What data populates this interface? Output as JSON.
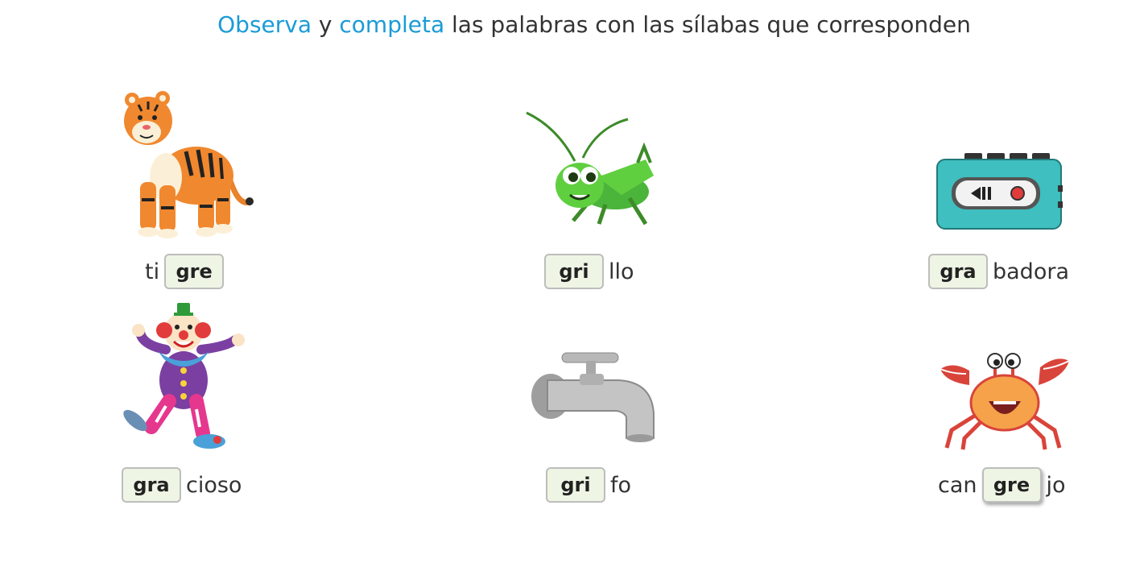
{
  "instruction": {
    "word1": "Observa",
    "connector": " y ",
    "word2": "completa",
    "rest": " las palabras con las sílabas que corresponden",
    "highlight_color": "#1a9bd7"
  },
  "items": [
    {
      "icon": "tiger",
      "prefix": "ti",
      "syllable": "gre",
      "suffix": ""
    },
    {
      "icon": "cricket",
      "prefix": "",
      "syllable": "gri",
      "suffix": "llo"
    },
    {
      "icon": "tape-recorder",
      "prefix": "",
      "syllable": "gra",
      "suffix": "badora"
    },
    {
      "icon": "clown",
      "prefix": "",
      "syllable": "gra",
      "suffix": "cioso"
    },
    {
      "icon": "faucet",
      "prefix": "",
      "syllable": "gri",
      "suffix": "fo"
    },
    {
      "icon": "crab",
      "prefix": "can",
      "syllable": "gre",
      "suffix": "jo"
    }
  ],
  "colors": {
    "slot_background": "#eef5e4",
    "slot_border": "#bdbdbd"
  }
}
